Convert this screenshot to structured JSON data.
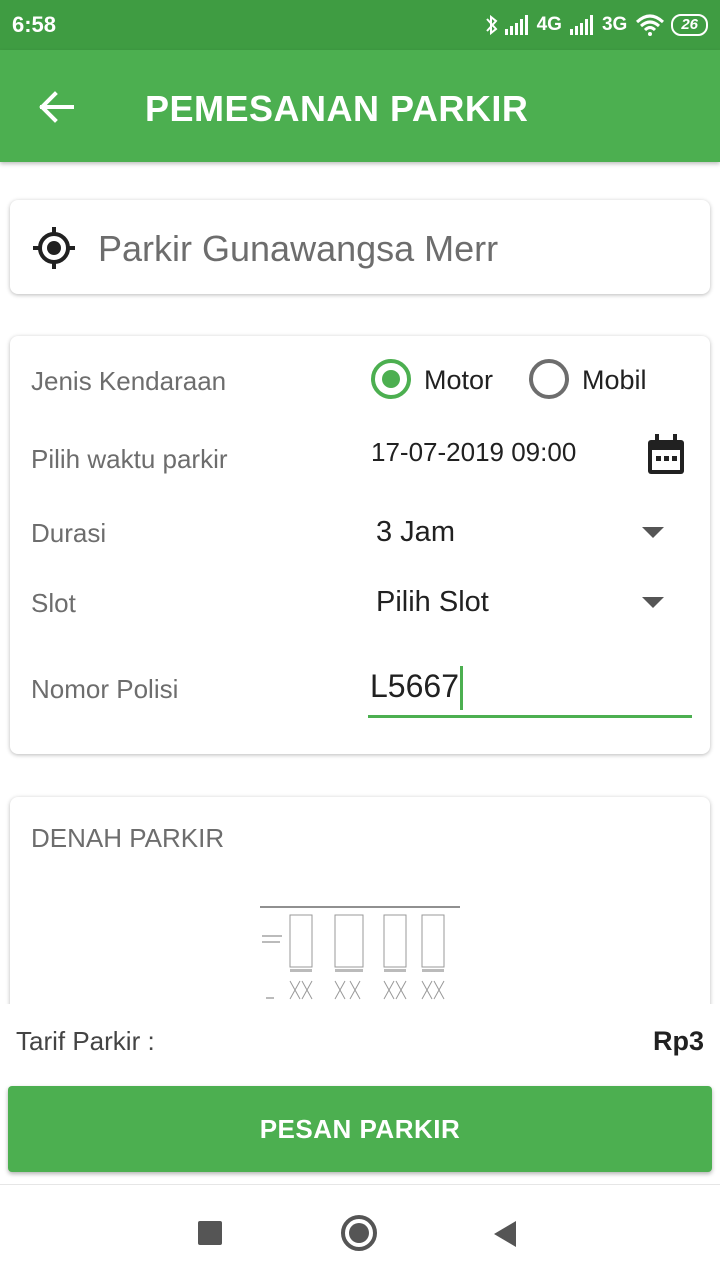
{
  "status_bar": {
    "time": "6:58",
    "network_1": "4G",
    "network_2": "3G",
    "battery": "26"
  },
  "app_bar": {
    "title": "PEMESANAN PARKIR"
  },
  "location": {
    "name": "Parkir Gunawangsa Merr"
  },
  "form": {
    "vehicle_label": "Jenis Kendaraan",
    "vehicle_options": [
      "Motor",
      "Mobil"
    ],
    "vehicle_selected": "Motor",
    "time_label": "Pilih waktu parkir",
    "time_value": "17-07-2019 09:00",
    "duration_label": "Durasi",
    "duration_value": "3 Jam",
    "slot_label": "Slot",
    "slot_value": "Pilih Slot",
    "plate_label": "Nomor Polisi",
    "plate_value": "L5667"
  },
  "map": {
    "title": "DENAH PARKIR"
  },
  "footer": {
    "tarif_label": "Tarif Parkir :",
    "tarif_value": "Rp3",
    "order_button": "PESAN PARKIR"
  },
  "colors": {
    "primary": "#4caf50",
    "status_bar": "#3f9c42"
  }
}
